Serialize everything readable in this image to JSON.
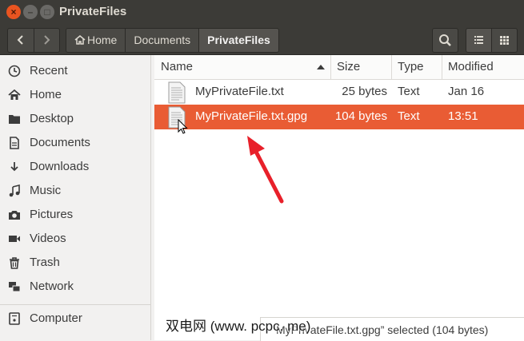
{
  "window": {
    "title": "PrivateFiles"
  },
  "breadcrumb": [
    "Home",
    "Documents",
    "PrivateFiles"
  ],
  "sidebar": {
    "items": [
      {
        "label": "Recent",
        "icon": "clock-icon"
      },
      {
        "label": "Home",
        "icon": "home-icon"
      },
      {
        "label": "Desktop",
        "icon": "folder-icon"
      },
      {
        "label": "Documents",
        "icon": "document-icon"
      },
      {
        "label": "Downloads",
        "icon": "download-icon"
      },
      {
        "label": "Music",
        "icon": "music-icon"
      },
      {
        "label": "Pictures",
        "icon": "camera-icon"
      },
      {
        "label": "Videos",
        "icon": "video-icon"
      },
      {
        "label": "Trash",
        "icon": "trash-icon"
      },
      {
        "label": "Network",
        "icon": "network-icon"
      },
      {
        "label": "Computer",
        "icon": "computer-icon"
      }
    ]
  },
  "columns": {
    "name": "Name",
    "size": "Size",
    "type": "Type",
    "modified": "Modified"
  },
  "files": [
    {
      "name": "MyPrivateFile.txt",
      "size": "25 bytes",
      "type": "Text",
      "modified": "Jan 16",
      "selected": false
    },
    {
      "name": "MyPrivateFile.txt.gpg",
      "size": "104 bytes",
      "type": "Text",
      "modified": "13:51",
      "selected": true
    }
  ],
  "status": {
    "text": "MyPrivateFile.txt.gpg” selected  (104 bytes)"
  },
  "watermark": "双电网 (www. pcpc. me)",
  "colors": {
    "accent": "#e95c34",
    "titlebar": "#3c3b37",
    "arrow": "#e8202a"
  }
}
